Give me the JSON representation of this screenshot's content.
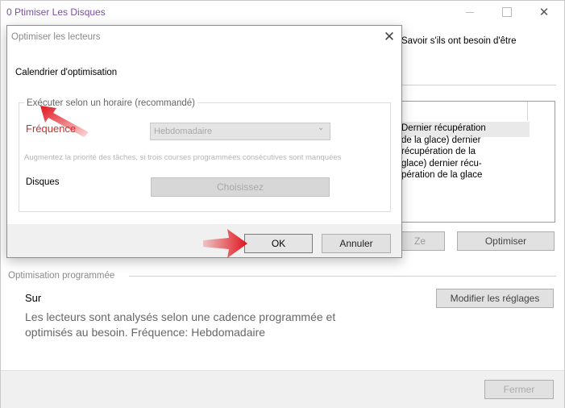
{
  "main_window": {
    "title": "0 Ptimiser Les Disques",
    "header_desc": "Savoir s'ils ont besoin d'être",
    "drive_list_text": "Dernier récupération de la glace) dernier récupération de la glace) dernier récu- pération de la glace",
    "analyze_label": "Ze",
    "optimize_label": "Optimiser",
    "scheduled": {
      "section_label": "Optimisation programmée",
      "status": "Sur",
      "change_settings_label": "Modifier les réglages",
      "description": "Les lecteurs sont analysés selon une cadence programmée et optimisés au besoin. Fréquence: Hebdomadaire"
    },
    "close_label": "Fermer"
  },
  "dialog": {
    "title": "Optimiser les lecteurs",
    "heading": "Calendrier d'optimisation",
    "group_label": "Exécuter selon un horaire (recommandé)",
    "frequency_label": "Fréquence",
    "frequency_value": "Hebdomadaire",
    "priority_option": "Augmentez la priorité des tâches, si trois courses programmées consécutives sont manquées",
    "disks_label": "Disques",
    "choose_label": "Choisissez",
    "ok_label": "OK",
    "cancel_label": "Annuler"
  },
  "colors": {
    "title_purple": "#7a4ea8",
    "annotation_red": "#d9262c",
    "frequency_red": "#c9302c"
  },
  "icons": {
    "dialog_close": "close-icon",
    "dropdown": "chevron-down-icon",
    "annotation_arrows": "red-arrow-icon"
  }
}
